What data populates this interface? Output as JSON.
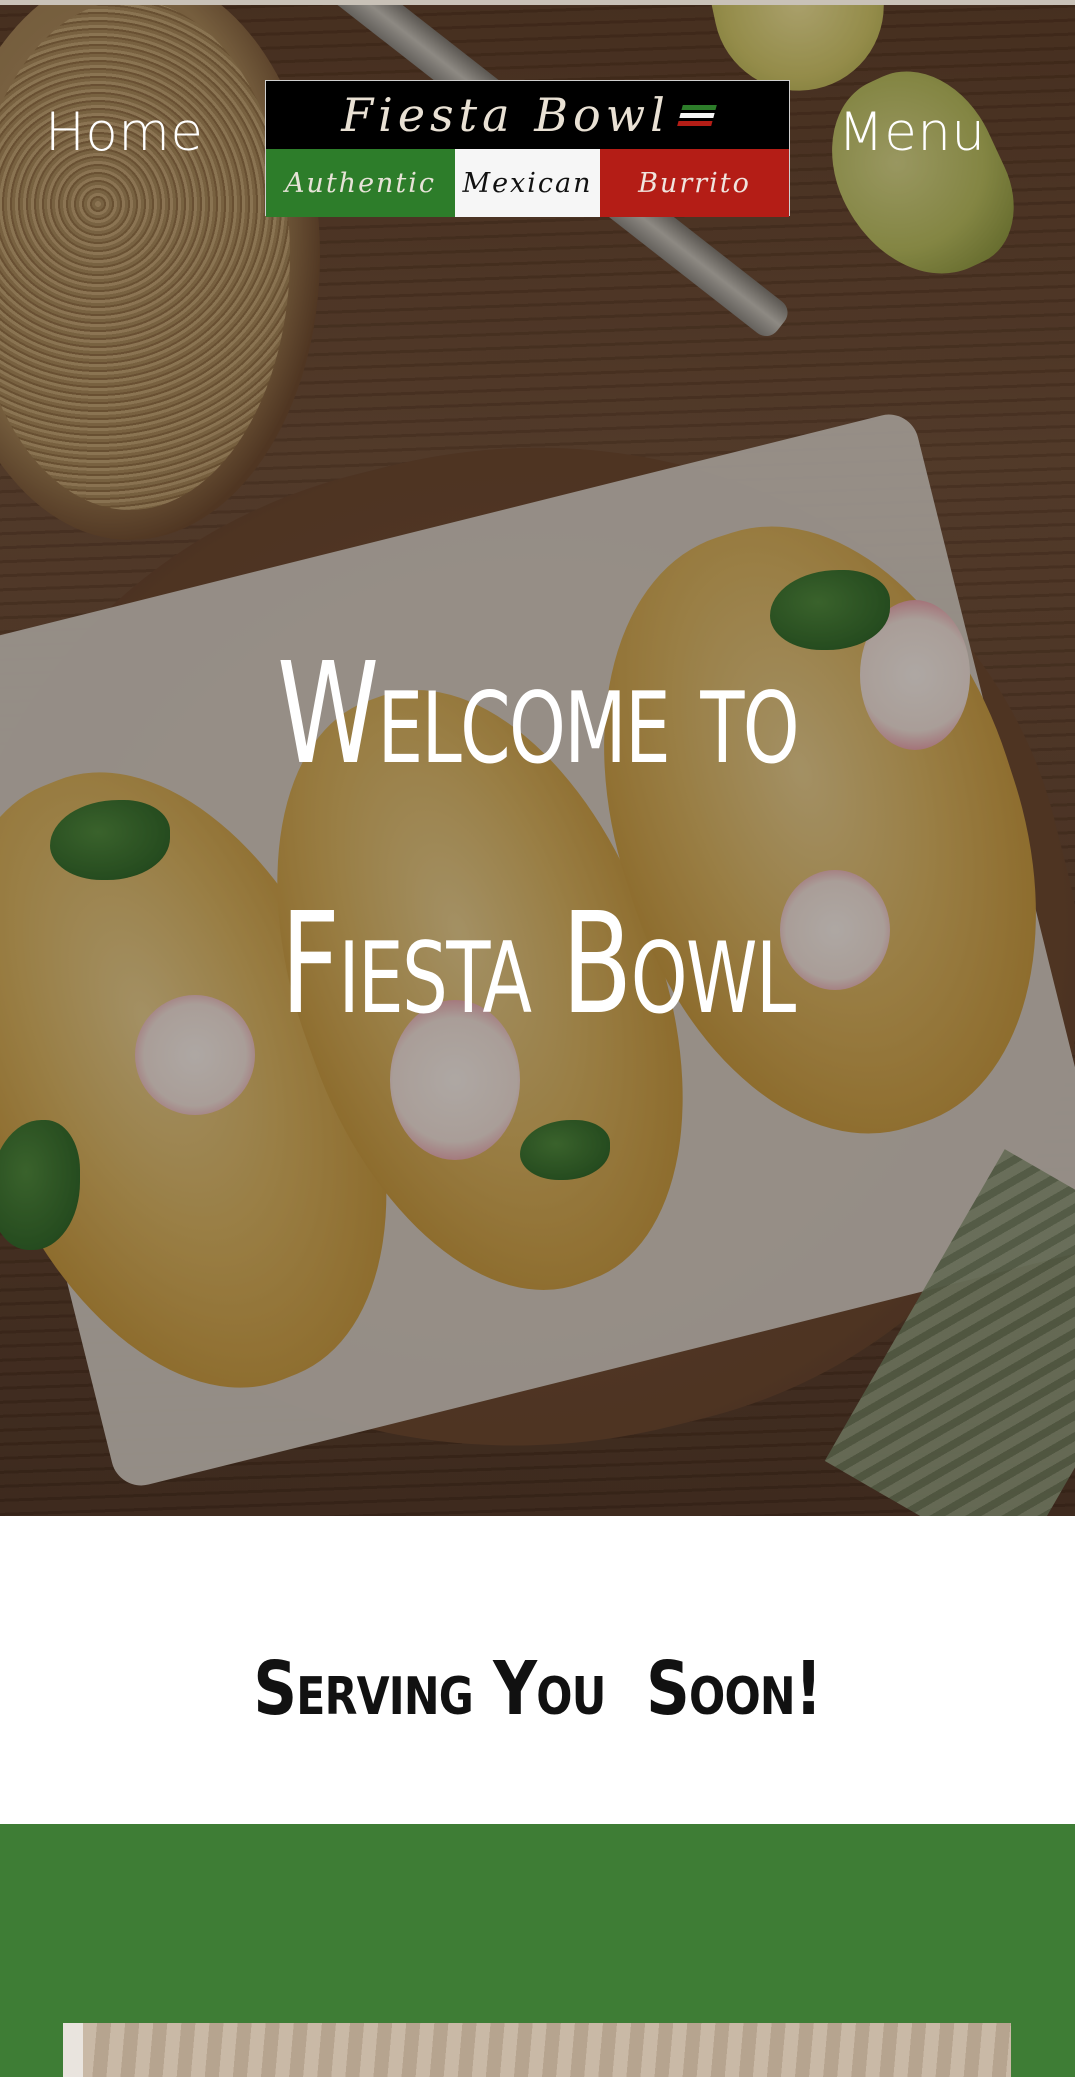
{
  "nav": {
    "home_label": "Home",
    "menu_label": "Menu"
  },
  "logo": {
    "title": "Fiesta Bowl",
    "tagline_left": "Authentic",
    "tagline_middle": "Mexican",
    "tagline_right": "Burrito",
    "colors": {
      "green": "#2d7d2a",
      "white": "#f6f6f6",
      "red": "#b41d16",
      "black": "#000000"
    }
  },
  "hero": {
    "title_line1": "Welcome to",
    "title_line2": "Fiesta Bowl",
    "text_color": "#ffffff"
  },
  "serving": {
    "text": "Serving You  Soon!"
  },
  "theme": {
    "section_green": "#3e7d35"
  }
}
